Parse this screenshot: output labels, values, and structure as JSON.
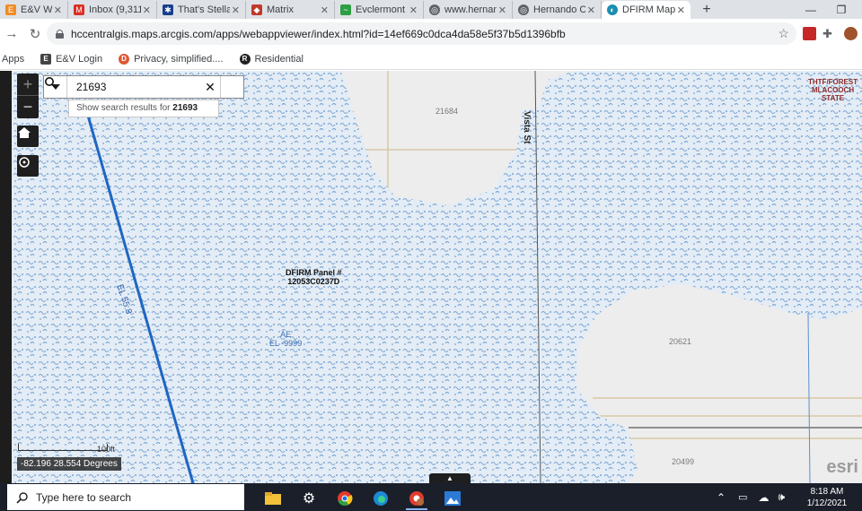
{
  "browser": {
    "tabs": [
      {
        "title": "E&V World",
        "icon_color": "#f28b25",
        "active": false
      },
      {
        "title": "Inbox (9,311",
        "icon_color": "#d93025",
        "active": false
      },
      {
        "title": "That's Stella",
        "icon_color": "#1a3e8c",
        "active": false
      },
      {
        "title": "Matrix",
        "icon_color": "#c0392b",
        "active": false
      },
      {
        "title": "Evclermont",
        "icon_color": "#2e9e44",
        "active": false
      },
      {
        "title": "www.hernan",
        "icon_color": "#5f6368",
        "active": false
      },
      {
        "title": "Hernando C",
        "icon_color": "#5f6368",
        "active": false
      },
      {
        "title": "DFIRM Map",
        "icon_color": "#1a8fb0",
        "active": true
      }
    ],
    "new_tab": "+",
    "url": "hccentralgis.maps.arcgis.com/apps/webappviewer/index.html?id=14ef669c0dca4da58e5f37b5d1396bfb",
    "bookmarks": [
      {
        "label": "Apps",
        "icon": "apps-icon"
      },
      {
        "label": "E&V Login",
        "icon": "ev-icon"
      },
      {
        "label": "Privacy, simplified....",
        "icon": "duckduckgo-icon"
      },
      {
        "label": "Residential",
        "icon": "residential-icon"
      }
    ]
  },
  "map": {
    "search": {
      "value": "21693",
      "suggestion_prefix": "Show search results for ",
      "suggestion_term": "21693"
    },
    "zoom_in": "+",
    "zoom_out": "−",
    "parcel_labels": [
      "21684",
      "20621",
      "20499"
    ],
    "panel_label_line1": "DFIRM Panel #",
    "panel_label_line2": "12053C0237D",
    "zone_label_line1": "AE",
    "zone_label_line2": "EL -9999",
    "elevation_label": "EL 55.8",
    "street_label": "Vista St",
    "state_label_line1": "THTF/FOREST",
    "state_label_line2": "MLACOOCH",
    "state_label_line3": "STATE",
    "scale_text": "100ft",
    "coordinates": "-82.196 28.554 Degrees",
    "esri_mark": "esri",
    "colors": {
      "flood_zone": "#6b9fd0",
      "base": "#ededed",
      "parcel_line": "#d8c9a6",
      "el_line": "#1f66c2"
    }
  },
  "taskbar": {
    "search_placeholder": "Type here to search",
    "time": "8:18 AM",
    "date": "1/12/2021"
  }
}
